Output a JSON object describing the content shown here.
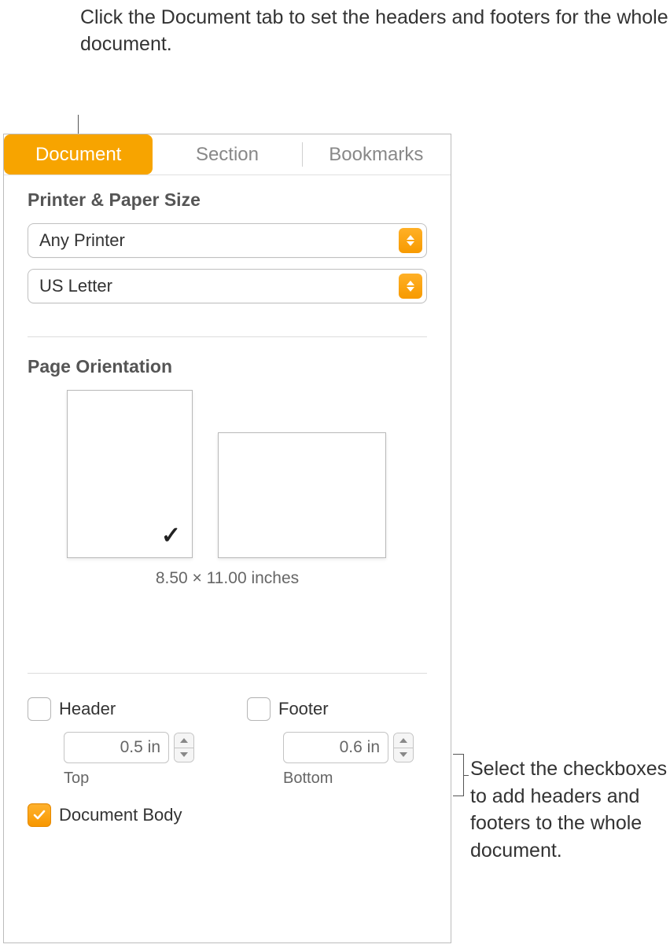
{
  "callouts": {
    "top": "Click the Document tab to set the headers and footers for the whole document.",
    "right": "Select the checkboxes to add headers and footers to the whole document."
  },
  "tabs": {
    "document": "Document",
    "section": "Section",
    "bookmarks": "Bookmarks"
  },
  "printer_section": {
    "title": "Printer & Paper Size",
    "printer": "Any Printer",
    "paper": "US Letter"
  },
  "orientation": {
    "title": "Page Orientation",
    "dimensions": "8.50 × 11.00 inches"
  },
  "hf": {
    "header_label": "Header",
    "footer_label": "Footer",
    "header_value": "0.5 in",
    "footer_value": "0.6 in",
    "top_label": "Top",
    "bottom_label": "Bottom"
  },
  "document_body_label": "Document Body"
}
